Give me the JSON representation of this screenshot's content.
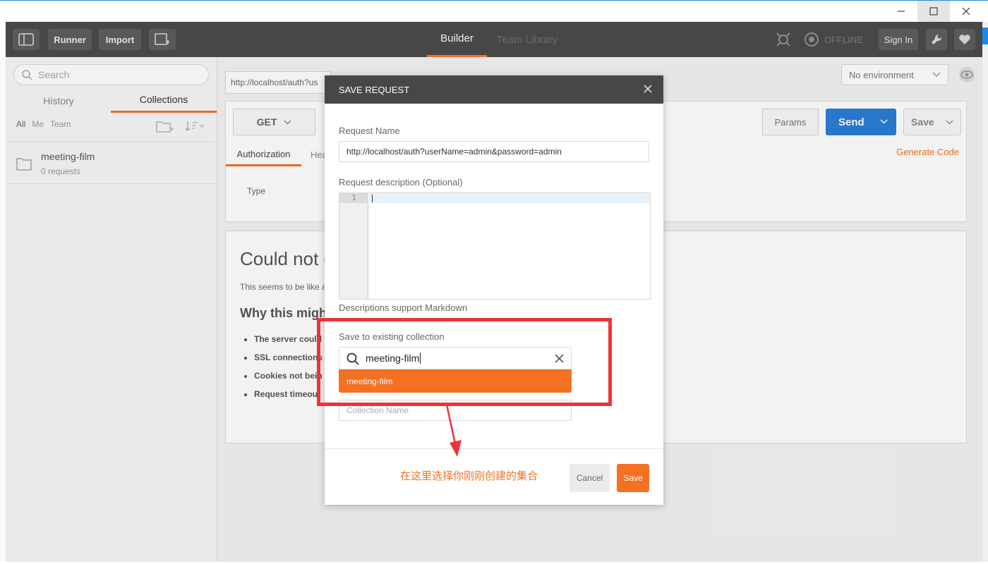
{
  "toolbar": {
    "runner": "Runner",
    "import": "Import",
    "tab_builder": "Builder",
    "tab_team": "Team Library",
    "offline": "OFFLINE",
    "sign_in": "Sign In"
  },
  "sidebar": {
    "search_placeholder": "Search",
    "tab_history": "History",
    "tab_collections": "Collections",
    "filters": [
      "All",
      "Me",
      "Team"
    ],
    "collection": {
      "name": "meeting-film",
      "count": "0 requests"
    }
  },
  "builder": {
    "url_tab": "http://localhost/auth?us",
    "environment": "No environment",
    "method": "GET",
    "params": "Params",
    "send": "Send",
    "save": "Save",
    "auth_tab": "Authorization",
    "headers_tab_partial": "Hea",
    "generate_code": "Generate Code",
    "type_label": "Type"
  },
  "response": {
    "title": "Could not g",
    "text": "This seems to be like ar",
    "why": "Why this might",
    "reasons": [
      "The server could",
      "SSL connections",
      "Cookies not bein",
      "Request timeout"
    ]
  },
  "modal": {
    "title": "SAVE REQUEST",
    "request_name_label": "Request Name",
    "request_name_value": "http://localhost/auth?userName=admin&password=admin",
    "desc_label": "Request description (Optional)",
    "line_number": "1",
    "markdown_note": "Descriptions support Markdown",
    "save_to_label": "Save to existing collection",
    "search_value": "meeting-film",
    "dropdown_item": "meeting-film",
    "collection_name_placeholder": "Collection Name",
    "note": "在这里选择你刚刚创建的集合",
    "cancel": "Cancel",
    "save": "Save"
  },
  "colors": {
    "accent": "#f47023",
    "send": "#2a7ed6",
    "annotation": "#ee3338",
    "toolbar": "#474747"
  }
}
